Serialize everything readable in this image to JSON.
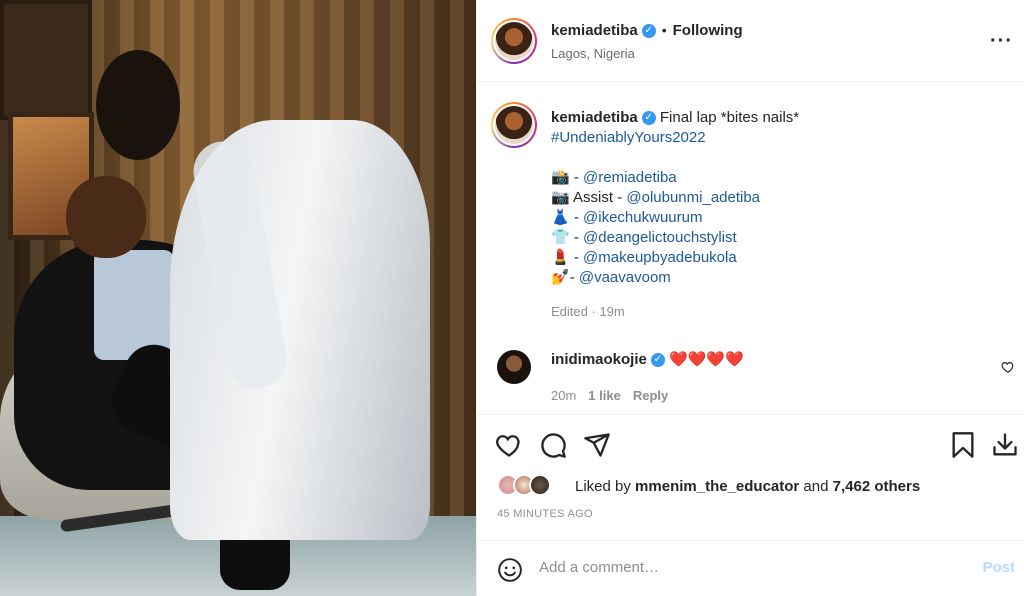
{
  "header": {
    "username": "kemiadetiba",
    "verified_glyph": "✓",
    "separator": "•",
    "follow_status": "Following",
    "location": "Lagos, Nigeria",
    "more_glyph": "···"
  },
  "caption": {
    "username": "kemiadetiba",
    "verified_glyph": "✓",
    "text": "Final lap *bites nails*",
    "hashtag": "#UndeniablyYours2022",
    "credits": [
      {
        "emoji": "📸",
        "label": " - ",
        "handle": "@remiadetiba"
      },
      {
        "emoji": "📷",
        "label": " Assist - ",
        "handle": "@olubunmi_adetiba"
      },
      {
        "emoji": "👗",
        "label": " - ",
        "handle": "@ikechukwuurum"
      },
      {
        "emoji": "👕",
        "label": " - ",
        "handle": "@deangelictouchstylist"
      },
      {
        "emoji": "💄",
        "label": " - ",
        "handle": "@makeupbyadebukola"
      },
      {
        "emoji": "💅",
        "label": "- ",
        "handle": "@vaavavoom"
      }
    ],
    "edited": "Edited · 19m"
  },
  "comment": {
    "username": "inidimaokojie",
    "verified_glyph": "✓",
    "text": "❤️❤️❤️❤️",
    "time": "20m",
    "likes": "1 like",
    "reply": "Reply"
  },
  "likes": {
    "prefix": "Liked by ",
    "user": "mmenim_the_educator",
    "middle": " and ",
    "others": "7,462 others"
  },
  "timestamp": "45 MINUTES AGO",
  "comment_box": {
    "placeholder": "Add a comment…",
    "post_label": "Post"
  },
  "icons": [
    "heart-icon",
    "comment-icon",
    "share-icon",
    "bookmark-icon",
    "download-icon",
    "emoji-icon",
    "more-icon"
  ],
  "colors": {
    "link": "#1e5a96",
    "verified": "#3897f0",
    "post_disabled": "#b3dbff",
    "heart": "#ed4956"
  }
}
